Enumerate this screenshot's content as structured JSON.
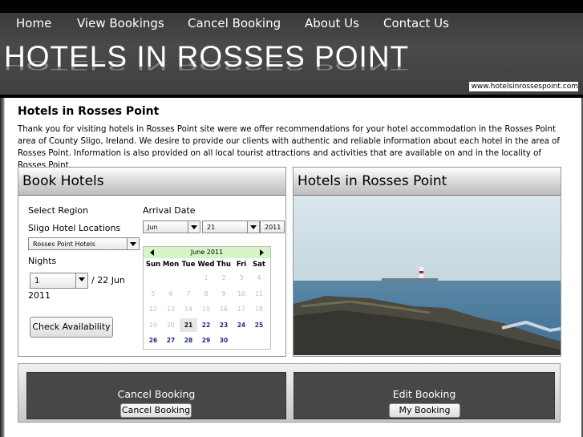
{
  "nav": {
    "items": [
      "Home",
      "View Bookings",
      "Cancel Booking",
      "About Us",
      "Contact Us"
    ]
  },
  "header": {
    "brand": "HOTELS IN ROSSES POINT",
    "url": "www.hotelsinrossespoint.com"
  },
  "intro": {
    "heading": "Hotels in Rosses Point",
    "text": "Thank you for visiting hotels in Rosses Point site were we offer recommendations for your hotel accommodation in the Rosses Point area of County Sligo, Ireland. We desire to provide our clients with authentic and reliable information about each hotel in the area of Rosses Point. Information is also provided on all local tourist attractions and activities that are available on and in the locality of Rosses Point."
  },
  "booking": {
    "title": "Book Hotels",
    "select_region_label": "Select Region",
    "location_label": "Sligo Hotel Locations",
    "location_value": "Rosses Point Hotels",
    "nights_label": "Nights",
    "nights_value": "1",
    "checkout_text": "/ 22 Jun",
    "checkout_year": "2011",
    "arrival_label": "Arrival Date",
    "arrival_month": "Jun",
    "arrival_day": "21",
    "arrival_year": "2011",
    "check_button": "Check Availability"
  },
  "calendar": {
    "month_label": "June 2011",
    "dow": [
      "Sun",
      "Mon",
      "Tue",
      "Wed",
      "Thu",
      "Fri",
      "Sat"
    ],
    "weeks": [
      [
        "",
        "",
        "",
        "1",
        "2",
        "3",
        "4"
      ],
      [
        "5",
        "6",
        "7",
        "8",
        "9",
        "10",
        "11"
      ],
      [
        "12",
        "13",
        "14",
        "15",
        "16",
        "17",
        "18"
      ],
      [
        "19",
        "20",
        "21",
        "22",
        "23",
        "24",
        "25"
      ],
      [
        "26",
        "27",
        "28",
        "29",
        "30",
        "",
        ""
      ]
    ],
    "selected_day": "21",
    "first_available_day": 21
  },
  "gallery": {
    "title": "Hotels in Rosses Point"
  },
  "actions": {
    "cancel_title": "Cancel Booking",
    "cancel_button": "Cancel Booking",
    "edit_title": "Edit Booking",
    "edit_button": "My Booking"
  }
}
